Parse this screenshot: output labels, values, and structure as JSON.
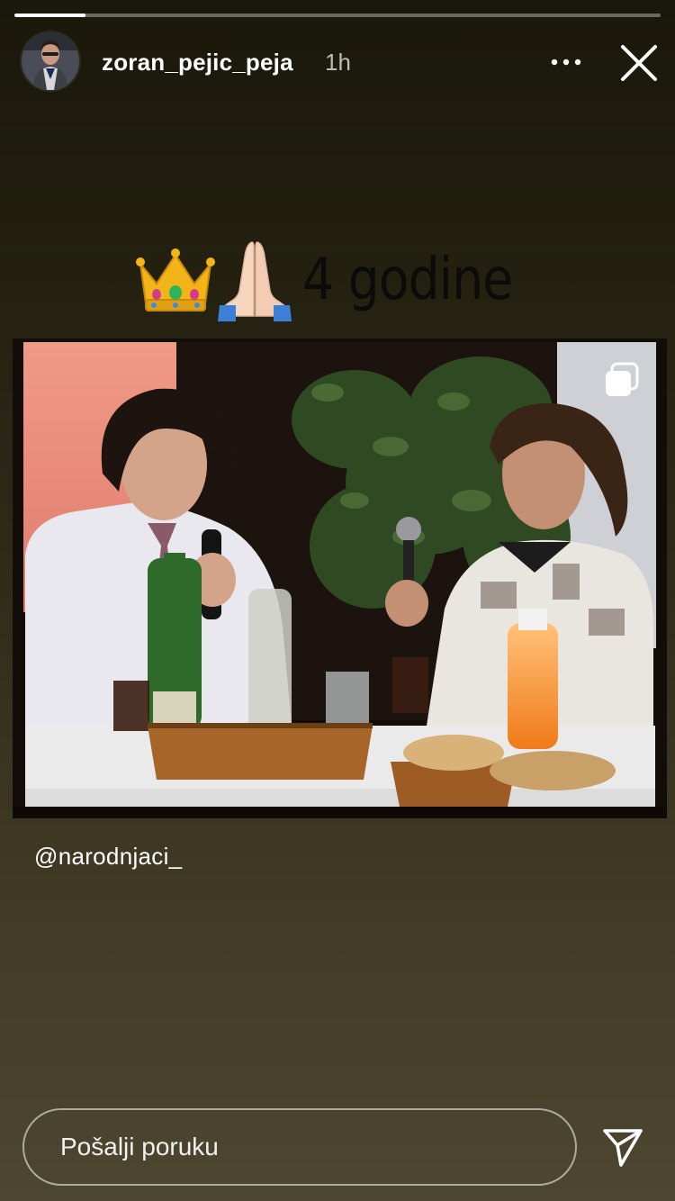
{
  "story": {
    "progress_fraction": 0.11,
    "username": "zoran_pejic_peja",
    "time_ago": "1h",
    "caption": {
      "emoji": "👑🙏🏻",
      "text": "4 godine"
    },
    "mention": "@narodnjaci_"
  },
  "icons": {
    "more": "more-dots-icon",
    "close": "close-icon",
    "repost": "repost-stack-icon",
    "send": "paper-plane-icon"
  },
  "reply": {
    "placeholder": "Pošalji poruku"
  },
  "colors": {
    "caption_text": "#0b0b09",
    "background_top": "#1a170c",
    "background_bottom": "#4d4630"
  }
}
